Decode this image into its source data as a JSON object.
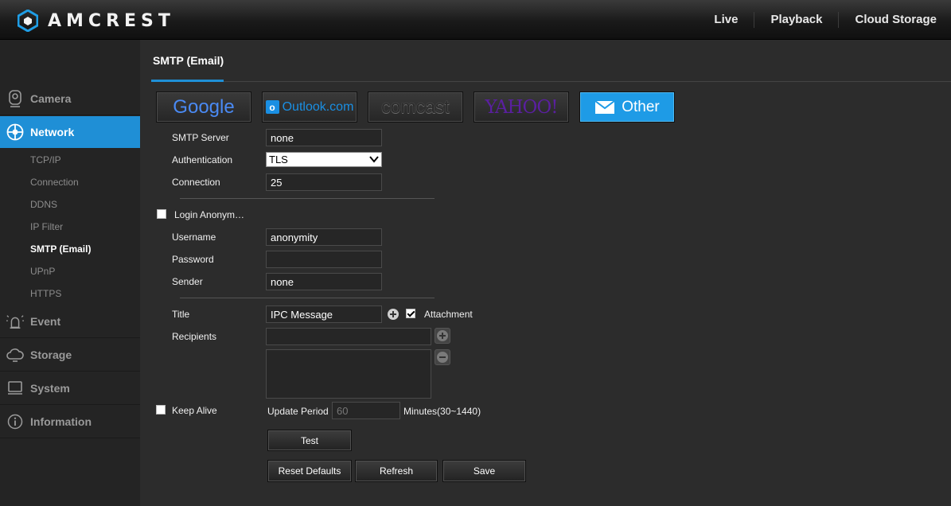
{
  "header": {
    "brand": "AMCREST",
    "nav": [
      "Live",
      "Playback",
      "Cloud Storage"
    ]
  },
  "sidebar": {
    "camera": "Camera",
    "network": "Network",
    "sub_items": [
      "TCP/IP",
      "Connection",
      "DDNS",
      "IP Filter",
      "SMTP (Email)",
      "UPnP",
      "HTTPS"
    ],
    "active_sub": "SMTP (Email)",
    "event": "Event",
    "storage": "Storage",
    "system": "System",
    "information": "Information",
    "accent_color": "#1f8fd6"
  },
  "page": {
    "title": "SMTP (Email)"
  },
  "providers": {
    "google": "Google",
    "outlook": "Outlook.com",
    "comcast": "comcast",
    "yahoo": "YAHOO!",
    "other": "Other",
    "selected": "Other"
  },
  "form": {
    "smtp_server_label": "SMTP Server",
    "smtp_server_value": "none",
    "authentication_label": "Authentication",
    "authentication_value": "TLS",
    "connection_label": "Connection",
    "connection_value": "25",
    "login_anonymous_label": "Login Anonym…",
    "login_anonymous_checked": false,
    "username_label": "Username",
    "username_value": "anonymity",
    "password_label": "Password",
    "password_value": "",
    "sender_label": "Sender",
    "sender_value": "none",
    "title_label": "Title",
    "title_value": "IPC Message",
    "attachment_label": "Attachment",
    "attachment_checked": true,
    "recipients_label": "Recipients",
    "recipients_value": "",
    "keep_alive_label": "Keep Alive",
    "keep_alive_checked": false,
    "update_period_label": "Update Period",
    "update_period_value": "60",
    "update_period_unit": "Minutes(30~1440)"
  },
  "buttons": {
    "test": "Test",
    "reset": "Reset Defaults",
    "refresh": "Refresh",
    "save": "Save"
  }
}
